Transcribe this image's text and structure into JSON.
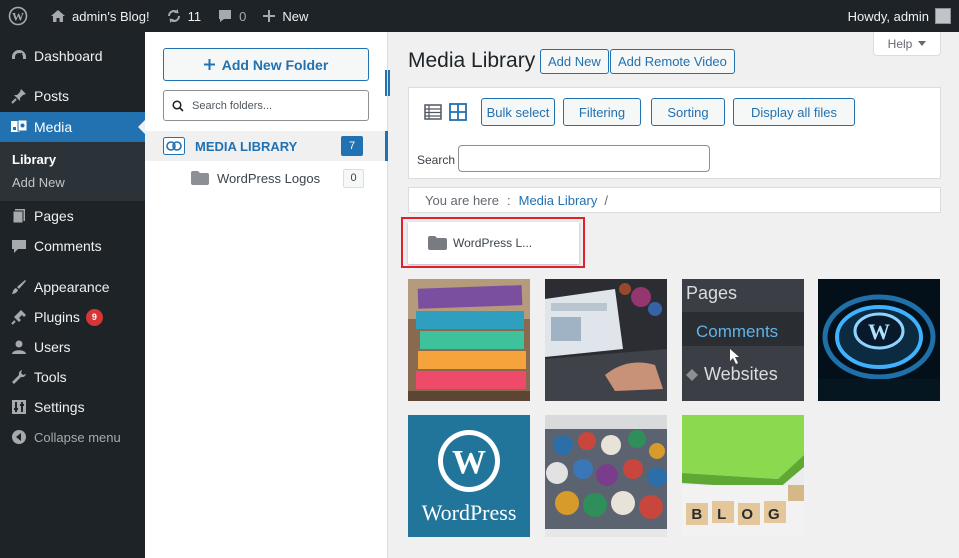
{
  "admin_bar": {
    "site_name": "admin's Blog!",
    "updates_count": "11",
    "comments_count": "0",
    "new_label": "New",
    "howdy": "Howdy, admin"
  },
  "sidebar": {
    "items": [
      {
        "label": "Dashboard",
        "icon": "dashboard-icon"
      },
      {
        "label": "Posts",
        "icon": "pin-icon"
      },
      {
        "label": "Media",
        "icon": "media-icon"
      },
      {
        "label": "Pages",
        "icon": "pages-icon"
      },
      {
        "label": "Comments",
        "icon": "comment-icon"
      },
      {
        "label": "Appearance",
        "icon": "brush-icon"
      },
      {
        "label": "Plugins",
        "icon": "plugin-icon",
        "badge": "9"
      },
      {
        "label": "Users",
        "icon": "user-icon"
      },
      {
        "label": "Tools",
        "icon": "wrench-icon"
      },
      {
        "label": "Settings",
        "icon": "settings-icon"
      }
    ],
    "submenu": [
      "Library",
      "Add New"
    ],
    "collapse_label": "Collapse menu"
  },
  "folders": {
    "add_button": "Add New Folder",
    "search_placeholder": "Search folders...",
    "root_label": "MEDIA LIBRARY",
    "root_count": "7",
    "children": [
      {
        "name": "WordPress Logos",
        "count": "0"
      }
    ]
  },
  "main": {
    "title": "Media Library",
    "add_new": "Add New",
    "add_remote": "Add Remote Video",
    "help": "Help",
    "toolbar": {
      "bulk_select": "Bulk select",
      "filtering": "Filtering",
      "sorting": "Sorting",
      "display_all": "Display all files",
      "search_label": "Search"
    },
    "breadcrumb": {
      "prefix": "You are here",
      "separator": ":",
      "link": "Media Library",
      "trail": "/"
    },
    "folder_card": "WordPress L...",
    "thumbnails": [
      {
        "name": "colorful-books"
      },
      {
        "name": "laptop-typing"
      },
      {
        "name": "pages-comments-websites"
      },
      {
        "name": "glowing-wordpress-logo"
      },
      {
        "name": "wordpress-logo"
      },
      {
        "name": "wordpress-badges"
      },
      {
        "name": "blog-cubes"
      }
    ],
    "thumb_texts": {
      "pages": "Pages",
      "comments": "Comments",
      "websites": "Websites",
      "wordpress": "WordPress",
      "blog": "BLOG"
    }
  },
  "colors": {
    "accent": "#2271b1",
    "admin_bg": "#1d2327",
    "highlight": "#e0202a"
  }
}
